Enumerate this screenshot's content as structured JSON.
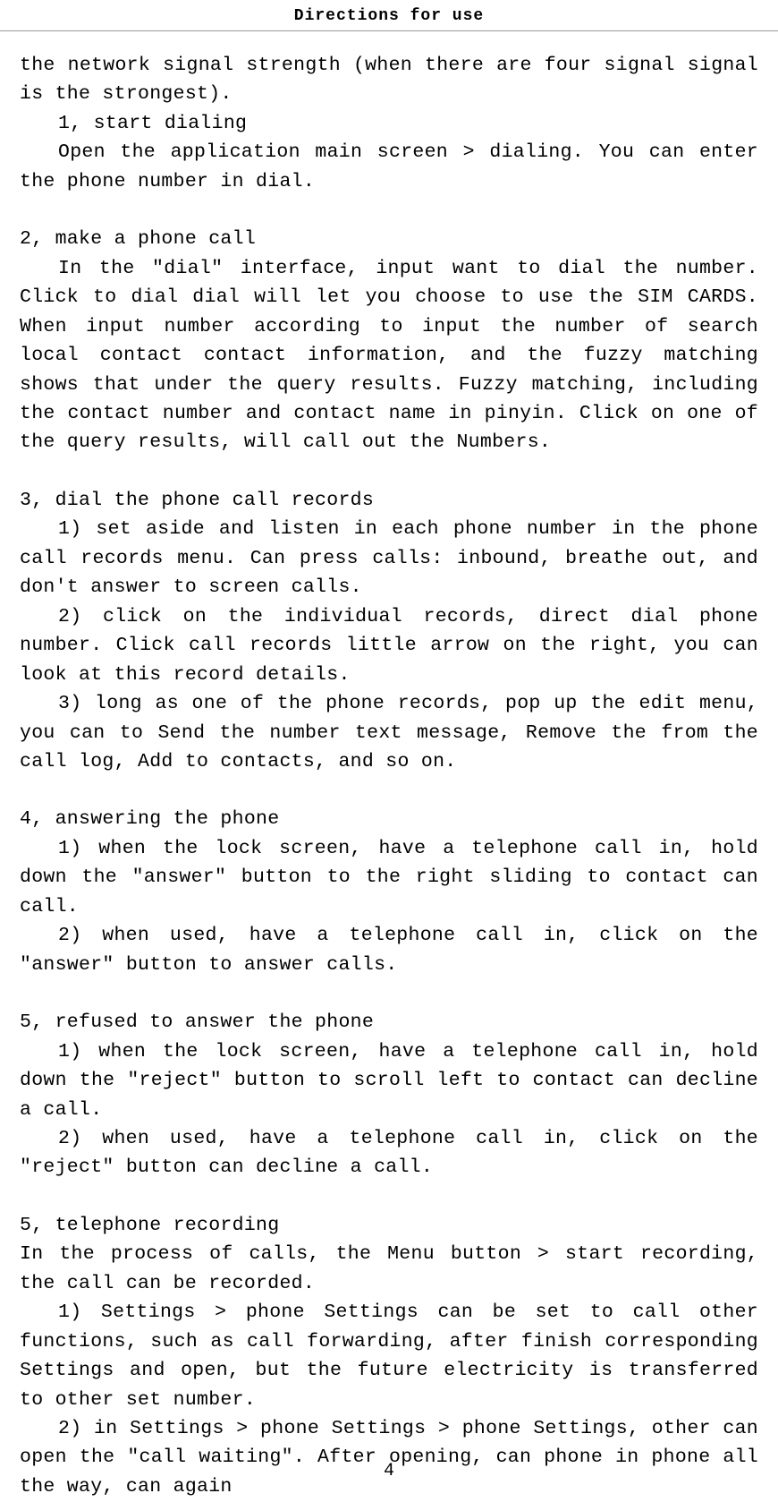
{
  "header": {
    "title": "Directions for use"
  },
  "body": {
    "p1": "the network signal strength (when there are four signal signal is the strongest).",
    "p2": "1, start dialing",
    "p3": "Open the application main screen > dialing. You can enter the phone number in dial.",
    "p4": "2, make a phone call",
    "p5": "In the \"dial\" interface, input want to dial the number. Click to dial dial will let you choose to use the SIM CARDS. When input number according to input the number of search local contact contact information, and the fuzzy matching shows that under the query results. Fuzzy matching, including the contact number and contact name in pinyin. Click on one of the query results, will call out the Numbers.",
    "p6": "3, dial the phone call records",
    "p7": "1) set aside and listen in each phone number in the phone call records menu. Can press calls: inbound, breathe out, and don't answer to screen calls.",
    "p8": "2) click on the individual records, direct dial phone number. Click call records little arrow on the right, you can look at this record details.",
    "p9": "3) long as one of the phone records, pop up the edit menu, you can to Send the number text message, Remove the from the call log, Add to contacts, and so on.",
    "p10": "4, answering the phone",
    "p11": "1) when the lock screen, have a telephone call in, hold down the \"answer\" button to the right sliding to contact can call.",
    "p12": "2) when used, have a telephone call in, click on the \"answer\" button to answer calls.",
    "p13": "5, refused to answer the phone",
    "p14": "1) when the lock screen, have a telephone call in, hold down the \"reject\" button to scroll left to contact can decline a call.",
    "p15": "2) when used, have a telephone call in, click on the \"reject\" button can decline a call.",
    "p16": "5, telephone recording",
    "p17": "In the process of calls, the Menu button > start recording, the call can be recorded.",
    "p18": "1) Settings > phone Settings can be set to call other functions, such as call forwarding, after finish corresponding Settings and open, but the future electricity is transferred to other set number.",
    "p19": "2) in Settings > phone Settings > phone Settings, other can open the \"call waiting\". After opening, can phone in phone all the way, can again"
  },
  "footer": {
    "page_number": "4"
  }
}
